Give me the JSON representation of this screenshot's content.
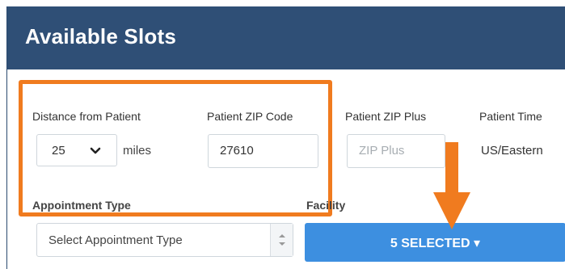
{
  "header": {
    "title": "Available Slots"
  },
  "distance": {
    "label": "Distance from Patient",
    "value": "25",
    "unit": "miles"
  },
  "zip": {
    "label": "Patient ZIP Code",
    "value": "27610"
  },
  "zip_plus": {
    "label": "Patient ZIP Plus",
    "placeholder": "ZIP Plus"
  },
  "timezone": {
    "label": "Patient Time",
    "value": "US/Eastern"
  },
  "appointment": {
    "label": "Appointment Type",
    "placeholder": "Select Appointment Type"
  },
  "facility": {
    "label": "Facility",
    "button_label": "5 SELECTED ▾"
  },
  "colors": {
    "header_bg": "#2f4f76",
    "highlight": "#f07b1f",
    "button": "#3d8fe0"
  }
}
